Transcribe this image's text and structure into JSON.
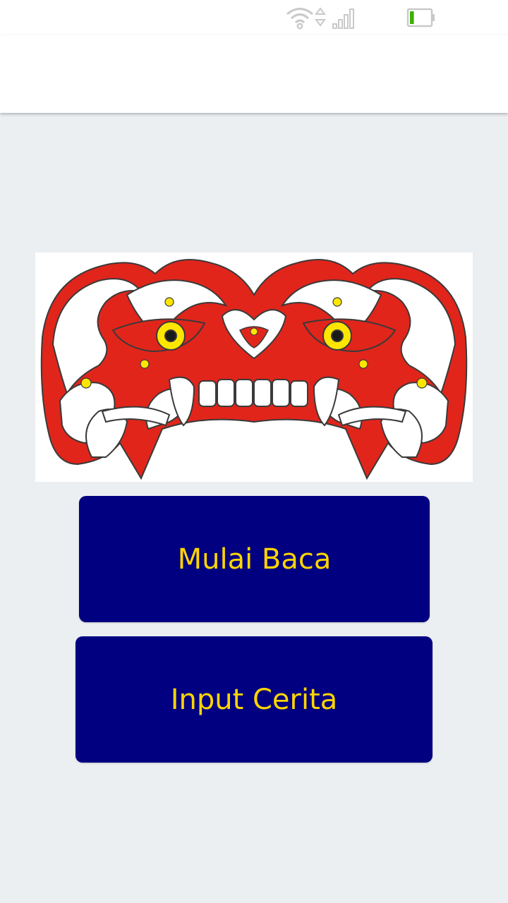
{
  "status_bar": {
    "icons": [
      "wifi-icon",
      "data-arrows-icon",
      "signal-icon",
      "battery-icon"
    ],
    "battery_level": 0.2,
    "battery_color": "#3cb000"
  },
  "banner": {
    "image": "dayak-ornament-illustration",
    "colors": {
      "red": "#e1251b",
      "white": "#ffffff",
      "yellow": "#ffe600",
      "outline": "#3a3a3a"
    }
  },
  "buttons": {
    "read_label": "Mulai Baca",
    "input_label": "Input Cerita"
  },
  "theme": {
    "button_bg": "#000080",
    "button_text": "#ffd500",
    "page_bg": "#eceff1"
  }
}
